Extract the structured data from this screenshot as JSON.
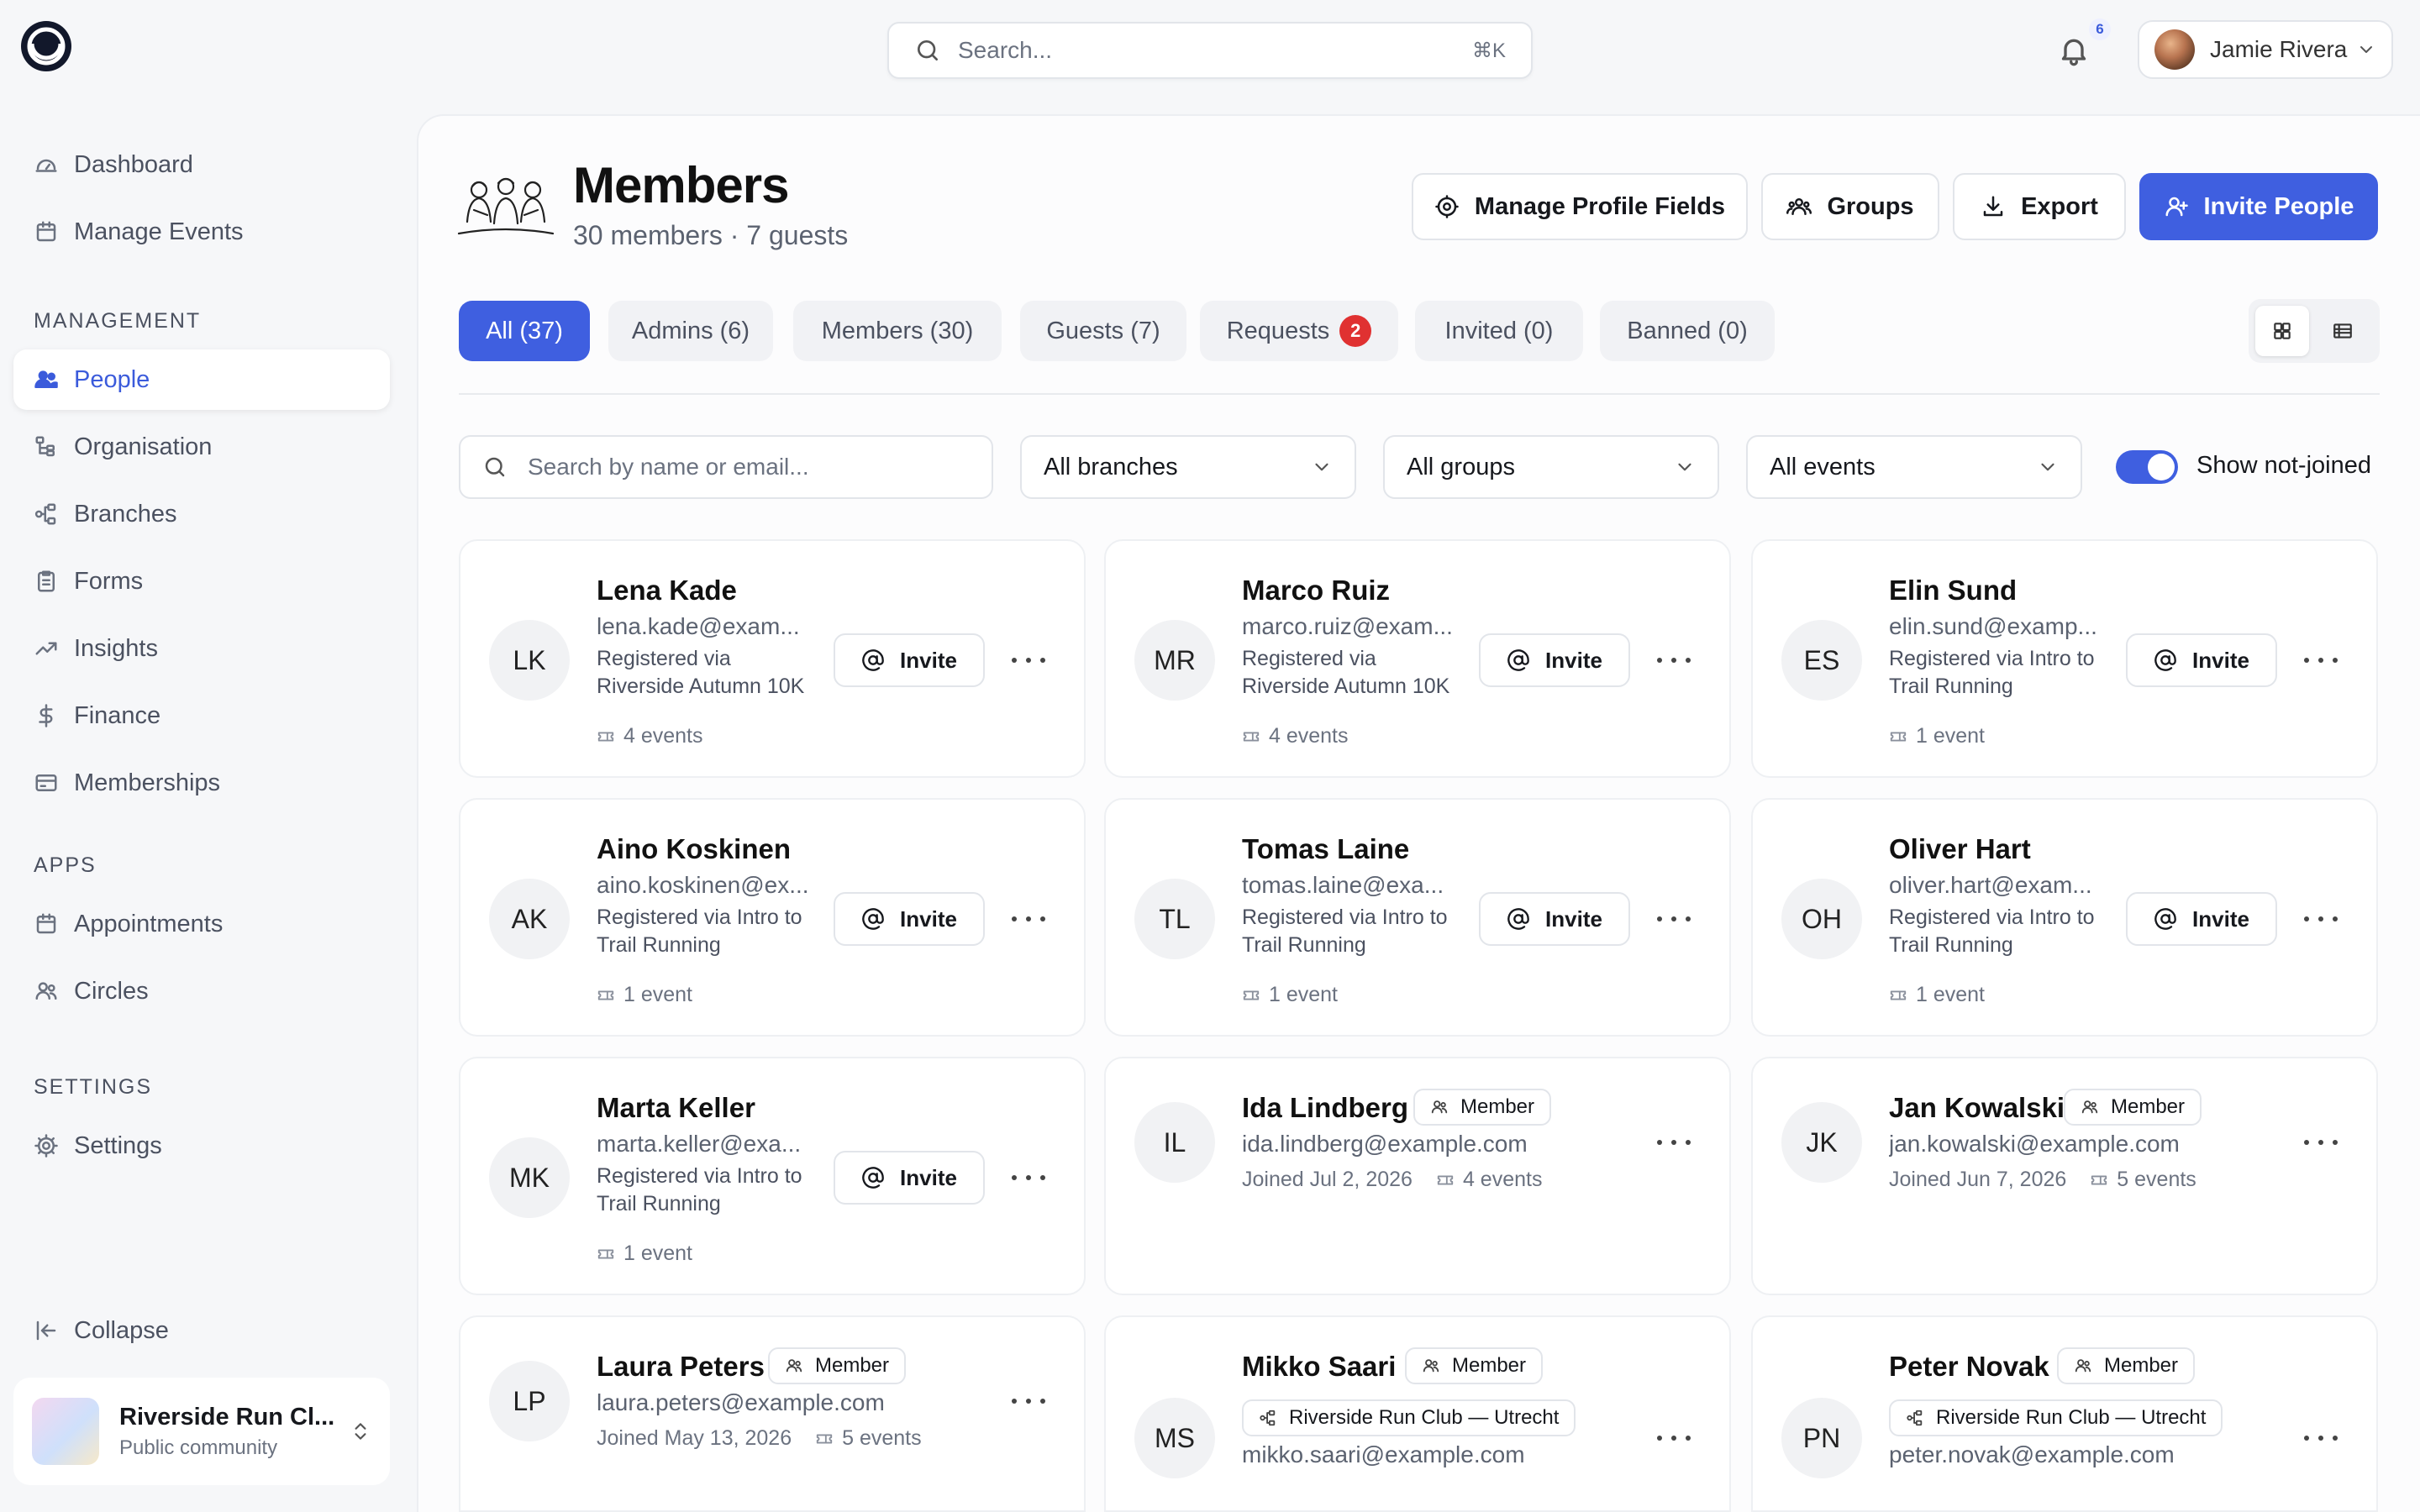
{
  "header": {
    "search_placeholder": "Search...",
    "search_shortcut": "⌘K",
    "notifications_count": "6",
    "user_name": "Jamie Rivera"
  },
  "sidebar": {
    "top_items": [
      {
        "label": "Dashboard",
        "icon": "dashboard-icon"
      },
      {
        "label": "Manage Events",
        "icon": "calendar-icon"
      }
    ],
    "management_title": "MANAGEMENT",
    "management_items": [
      {
        "label": "People",
        "icon": "people-icon",
        "active": true
      },
      {
        "label": "Organisation",
        "icon": "hierarchy-icon"
      },
      {
        "label": "Branches",
        "icon": "branches-icon"
      },
      {
        "label": "Forms",
        "icon": "clipboard-icon"
      },
      {
        "label": "Insights",
        "icon": "trend-icon"
      },
      {
        "label": "Finance",
        "icon": "dollar-icon"
      },
      {
        "label": "Memberships",
        "icon": "card-icon"
      }
    ],
    "apps_title": "APPS",
    "apps_items": [
      {
        "label": "Appointments",
        "icon": "calendar-icon"
      },
      {
        "label": "Circles",
        "icon": "users-icon"
      }
    ],
    "settings_title": "SETTINGS",
    "settings_items": [
      {
        "label": "Settings",
        "icon": "gear-icon"
      }
    ],
    "collapse_label": "Collapse",
    "org": {
      "name": "Riverside Run Cl...",
      "subtitle": "Public community"
    }
  },
  "page": {
    "title": "Members",
    "subtitle": "30 members · 7 guests",
    "buttons": {
      "manage_fields": "Manage Profile Fields",
      "groups": "Groups",
      "export": "Export",
      "invite": "Invite People"
    },
    "accent_color": "#3f5fe0"
  },
  "tabs": [
    {
      "label": "All (37)",
      "active": true
    },
    {
      "label": "Admins (6)"
    },
    {
      "label": "Members (30)"
    },
    {
      "label": "Guests (7)"
    },
    {
      "label": "Requests",
      "badge": "2"
    },
    {
      "label": "Invited (0)"
    },
    {
      "label": "Banned (0)"
    }
  ],
  "filters": {
    "search_placeholder": "Search by name or email...",
    "branches": "All branches",
    "groups": "All groups",
    "events": "All events",
    "toggle_label": "Show not-joined",
    "toggle_on": true
  },
  "invite_label": "Invite",
  "members": [
    {
      "initials": "LK",
      "name": "Lena Kade",
      "email": "lena.kade@exam...",
      "registration": "Registered via Riverside Autumn 10K",
      "events": "4 events"
    },
    {
      "initials": "MR",
      "name": "Marco Ruiz",
      "email": "marco.ruiz@exam...",
      "registration": "Registered via Riverside Autumn 10K",
      "events": "4 events"
    },
    {
      "initials": "ES",
      "name": "Elin Sund",
      "email": "elin.sund@examp...",
      "registration": "Registered via Intro to Trail Running",
      "events": "1 event"
    },
    {
      "initials": "AK",
      "name": "Aino Koskinen",
      "email": "aino.koskinen@ex...",
      "registration": "Registered via Intro to Trail Running",
      "events": "1 event"
    },
    {
      "initials": "TL",
      "name": "Tomas Laine",
      "email": "tomas.laine@exa...",
      "registration": "Registered via Intro to Trail Running",
      "events": "1 event"
    },
    {
      "initials": "OH",
      "name": "Oliver Hart",
      "email": "oliver.hart@exam...",
      "registration": "Registered via Intro to Trail Running",
      "events": "1 event"
    },
    {
      "initials": "MK",
      "name": "Marta Keller",
      "email": "marta.keller@exa...",
      "registration": "Registered via Intro to Trail Running",
      "events": "1 event"
    },
    {
      "initials": "IL",
      "name": "Ida Lindberg",
      "role": "Member",
      "email": "ida.lindberg@example.com",
      "joined": "Joined Jul 2, 2026",
      "events": "4 events"
    },
    {
      "initials": "JK",
      "name": "Jan Kowalski",
      "role": "Member",
      "email": "jan.kowalski@example.com",
      "joined": "Joined Jun 7, 2026",
      "events": "5 events"
    },
    {
      "initials": "LP",
      "name": "Laura Peters",
      "role": "Member",
      "email": "laura.peters@example.com",
      "joined": "Joined May 13, 2026",
      "events": "5 events"
    },
    {
      "initials": "MS",
      "name": "Mikko Saari",
      "role": "Member",
      "branch": "Riverside Run Club — Utrecht",
      "email": "mikko.saari@example.com"
    },
    {
      "initials": "PN",
      "name": "Peter Novak",
      "role": "Member",
      "branch": "Riverside Run Club — Utrecht",
      "email": "peter.novak@example.com"
    }
  ]
}
